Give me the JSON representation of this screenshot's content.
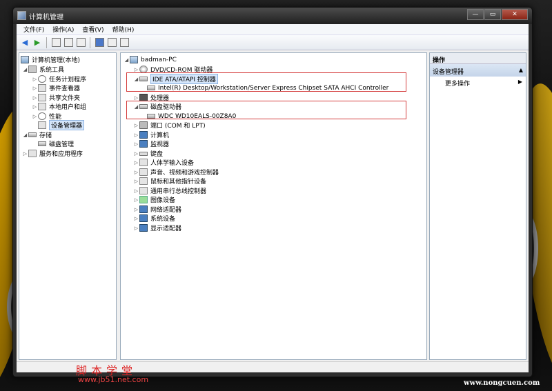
{
  "window": {
    "title": "计算机管理",
    "close_glyph": "✕",
    "min_glyph": "—",
    "max_glyph": "▭"
  },
  "menu": [
    "文件(F)",
    "操作(A)",
    "查看(V)",
    "帮助(H)"
  ],
  "left_tree": {
    "root": "计算机管理(本地)",
    "system_tools": "系统工具",
    "task_scheduler": "任务计划程序",
    "event_viewer": "事件查看器",
    "shared_folders": "共享文件夹",
    "local_users": "本地用户和组",
    "performance": "性能",
    "device_manager": "设备管理器",
    "storage": "存储",
    "disk_management": "磁盘管理",
    "services_apps": "服务和应用程序"
  },
  "device_tree": {
    "computer": "badman-PC",
    "dvd": "DVD/CD-ROM 驱动器",
    "ide": "IDE ATA/ATAPI 控制器",
    "ide_child": "Intel(R) Desktop/Workstation/Server Express Chipset SATA AHCI Controller",
    "processor": "处理器",
    "disk_drives": "磁盘驱动器",
    "disk_child": "WDC WD10EALS-00Z8A0",
    "ports": "端口 (COM 和 LPT)",
    "computer_cat": "计算机",
    "monitors": "监视器",
    "keyboard": "键盘",
    "hid": "人体学输入设备",
    "sound": "声音、视频和游戏控制器",
    "mouse": "鼠标和其他指针设备",
    "usb": "通用串行总线控制器",
    "imaging": "图像设备",
    "network": "网络适配器",
    "system_devices": "系统设备",
    "display": "显示适配器"
  },
  "actions": {
    "header": "操作",
    "group": "设备管理器",
    "more": "更多操作"
  },
  "watermarks": {
    "site_cn": "脚本学堂",
    "site_url": "www.jb51.net.com",
    "bottom_right": "www.nongcuen.com"
  }
}
